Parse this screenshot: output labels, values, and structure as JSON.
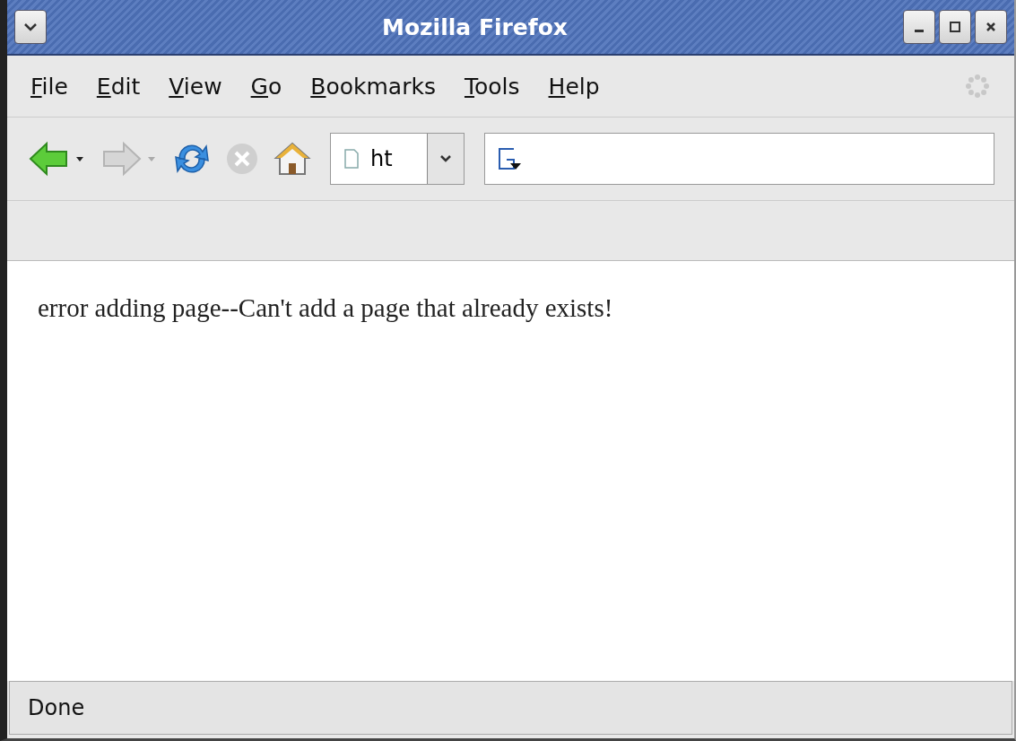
{
  "window": {
    "title": "Mozilla Firefox"
  },
  "menu": [
    "File",
    "Edit",
    "View",
    "Go",
    "Bookmarks",
    "Tools",
    "Help"
  ],
  "toolbar": {
    "buttons": [
      {
        "kind": "back",
        "disabled": false
      },
      {
        "kind": "forward",
        "disabled": true
      },
      {
        "kind": "reload",
        "disabled": false
      },
      {
        "kind": "stop",
        "disabled": true
      },
      {
        "kind": "home",
        "disabled": false
      }
    ],
    "address": {
      "value": "ht"
    }
  },
  "content": {
    "message": "error adding page--Can't add a page that already exists!"
  },
  "status_bar": {
    "text": "Done"
  }
}
